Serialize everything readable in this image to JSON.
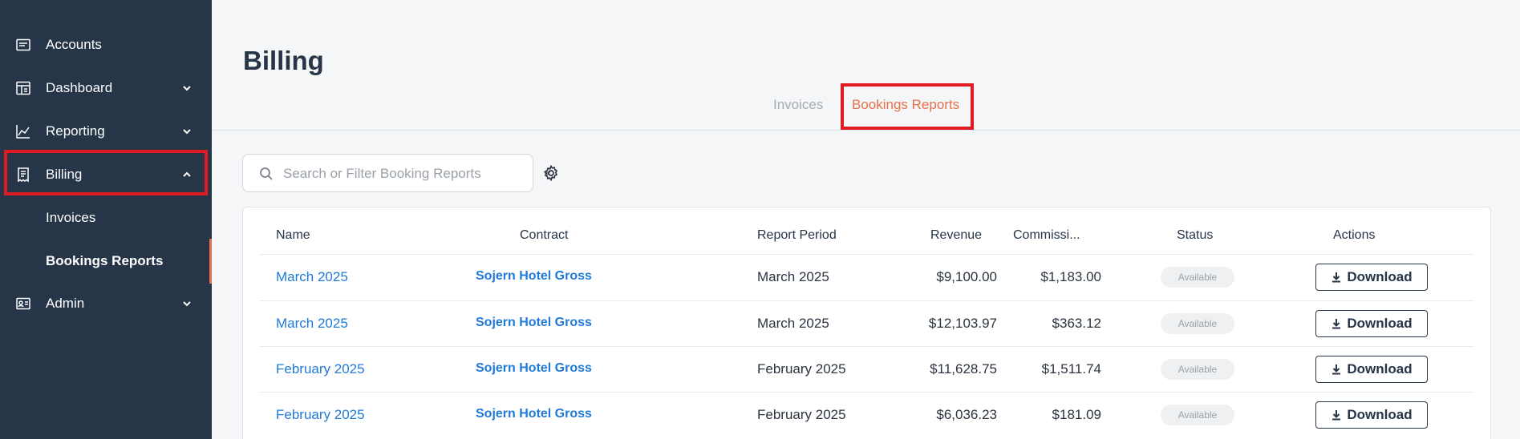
{
  "sidebar": {
    "items": [
      {
        "label": "Accounts",
        "icon": "accounts-icon"
      },
      {
        "label": "Dashboard",
        "icon": "dashboard-icon"
      },
      {
        "label": "Reporting",
        "icon": "reporting-icon"
      },
      {
        "label": "Billing",
        "icon": "billing-icon"
      },
      {
        "label": "Admin",
        "icon": "admin-icon"
      }
    ],
    "billing_sub": [
      {
        "label": "Invoices"
      },
      {
        "label": "Bookings Reports"
      }
    ]
  },
  "page": {
    "title": "Billing"
  },
  "tabs": [
    {
      "label": "Invoices",
      "active": false
    },
    {
      "label": "Bookings Reports",
      "active": true
    }
  ],
  "search": {
    "placeholder": "Search or Filter Booking Reports"
  },
  "table": {
    "columns": [
      "Name",
      "Contract",
      "Report Period",
      "Revenue",
      "Commissi...",
      "Status",
      "Actions"
    ],
    "rows": [
      {
        "name": "March 2025",
        "contract": "Sojern Hotel Gross",
        "period": "March 2025",
        "revenue": "$9,100.00",
        "commission": "$1,183.00",
        "status": "Available",
        "action": "Download"
      },
      {
        "name": "March 2025",
        "contract": "Sojern Hotel Gross",
        "period": "March 2025",
        "revenue": "$12,103.97",
        "commission": "$363.12",
        "status": "Available",
        "action": "Download"
      },
      {
        "name": "February 2025",
        "contract": "Sojern Hotel Gross",
        "period": "February 2025",
        "revenue": "$11,628.75",
        "commission": "$1,511.74",
        "status": "Available",
        "action": "Download"
      },
      {
        "name": "February 2025",
        "contract": "Sojern Hotel Gross",
        "period": "February 2025",
        "revenue": "$6,036.23",
        "commission": "$181.09",
        "status": "Available",
        "action": "Download"
      }
    ]
  },
  "colors": {
    "sidebar_bg": "#263548",
    "accent": "#e8704b",
    "link": "#1f7ad8",
    "highlight": "#e01b24"
  }
}
